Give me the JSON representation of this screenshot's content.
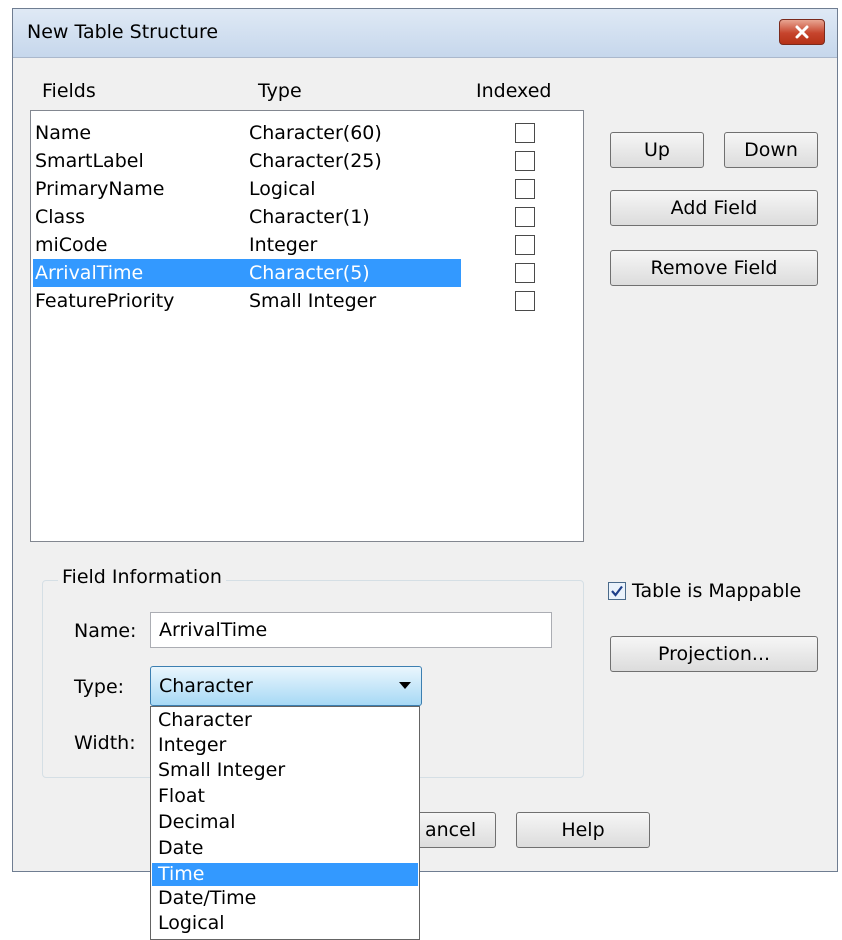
{
  "window": {
    "title": "New Table Structure",
    "close_icon": "close-icon"
  },
  "columns": {
    "fields": "Fields",
    "type": "Type",
    "indexed": "Indexed"
  },
  "fields": [
    {
      "name": "Name",
      "type": "Character(60)",
      "indexed": false,
      "selected": false
    },
    {
      "name": "SmartLabel",
      "type": "Character(25)",
      "indexed": false,
      "selected": false
    },
    {
      "name": "PrimaryName",
      "type": "Logical",
      "indexed": false,
      "selected": false
    },
    {
      "name": "Class",
      "type": "Character(1)",
      "indexed": false,
      "selected": false
    },
    {
      "name": "miCode",
      "type": "Integer",
      "indexed": false,
      "selected": false
    },
    {
      "name": "ArrivalTime",
      "type": "Character(5)",
      "indexed": false,
      "selected": true
    },
    {
      "name": "FeaturePriority",
      "type": "Small Integer",
      "indexed": false,
      "selected": false
    }
  ],
  "buttons": {
    "up": "Up",
    "down": "Down",
    "add_field": "Add Field",
    "remove_field": "Remove Field",
    "projection": "Projection...",
    "cancel": "ancel",
    "help": "Help"
  },
  "field_info": {
    "group_label": "Field Information",
    "name_label": "Name:",
    "name_value": "ArrivalTime",
    "type_label": "Type:",
    "type_value": "Character",
    "width_label": "Width:"
  },
  "mappable": {
    "label": "Table is Mappable",
    "checked": true
  },
  "type_options": [
    "Character",
    "Integer",
    "Small Integer",
    "Float",
    "Decimal",
    "Date",
    "Time",
    "Date/Time",
    "Logical"
  ],
  "type_options_highlighted": "Time",
  "colors": {
    "selection": "#3399ff",
    "dialog_bg": "#f0f0f0",
    "close_red": "#c6442c"
  }
}
